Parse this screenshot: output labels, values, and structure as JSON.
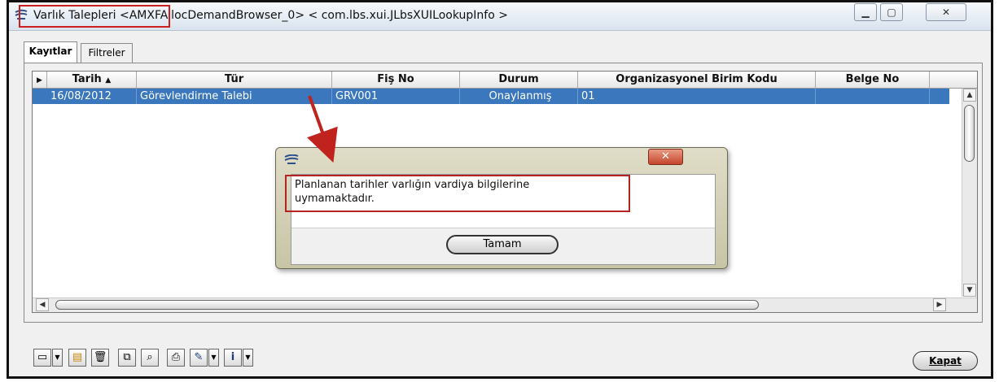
{
  "window": {
    "title": "Varlık Talepleri <AMXFAllocDemandBrowser_0> < com.lbs.xui.JLbsXUILookupInfo >",
    "controls": [
      "minimize",
      "maximize",
      "close"
    ]
  },
  "tabs": [
    {
      "label": "Kayıtlar",
      "active": true
    },
    {
      "label": "Filtreler",
      "active": false
    }
  ],
  "grid": {
    "columns": [
      "Tarih",
      "Tür",
      "Fiş No",
      "Durum",
      "Organizasyonel Birim Kodu",
      "Belge No"
    ],
    "rows": [
      {
        "selected": true,
        "cells": [
          "16/08/2012",
          "Görevlendirme Talebi",
          "GRV001",
          "Onaylanmış",
          "01",
          ""
        ]
      }
    ]
  },
  "toolbar": {
    "icons": [
      "new-icon",
      "open-icon",
      "delete-icon",
      "copy-icon",
      "view-icon",
      "print-icon",
      "edit-icon",
      "info-icon"
    ]
  },
  "close_label": "Kapat",
  "dialog": {
    "message_line1": "Planlanan tarihler varlığın vardiya bilgilerine",
    "message_line2": "uymamaktadır.",
    "ok_label": "Tamam"
  },
  "colors": {
    "selection": "#3a77bd",
    "highlight": "#cc1f1f"
  }
}
